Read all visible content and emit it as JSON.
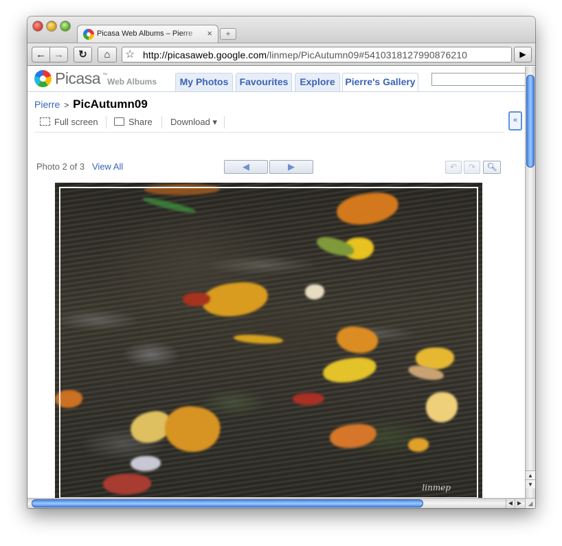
{
  "browser": {
    "tab_title": "Picasa Web Albums – Pierre",
    "tab_close": "×",
    "new_tab": "+",
    "url_host": "http://picasaweb.google.com",
    "url_path": "/linmep/PicAutumn09#5410318127990876210"
  },
  "header": {
    "brand": "Picasa",
    "trademark": "™",
    "subtitle": "Web Albums",
    "tabs": [
      {
        "label": "My Photos"
      },
      {
        "label": "Favourites"
      },
      {
        "label": "Explore"
      },
      {
        "label": "Pierre's Gallery",
        "active": true
      }
    ],
    "search_value": ""
  },
  "breadcrumb": {
    "owner": "Pierre",
    "separator": ">",
    "album": "PicAutumn09"
  },
  "actions": {
    "full_screen": "Full screen",
    "share": "Share",
    "download": "Download",
    "download_caret": "▾"
  },
  "viewer": {
    "photo_count": "Photo 2 of 3",
    "view_all": "View All",
    "prev_arrow": "◀",
    "next_arrow": "▶",
    "collapse": "«",
    "watermark": "linmep"
  },
  "icons": {
    "back": "arrow-left",
    "forward": "arrow-right",
    "reload": "reload",
    "home": "home",
    "bookmark": "star",
    "go": "play",
    "rotate_left": "rotate-left",
    "rotate_right": "rotate-right",
    "zoom": "zoom-in"
  },
  "colors": {
    "link": "#3a63b5",
    "tab_bg": "#e8eef8",
    "scroll_thumb": "#3979d8"
  }
}
